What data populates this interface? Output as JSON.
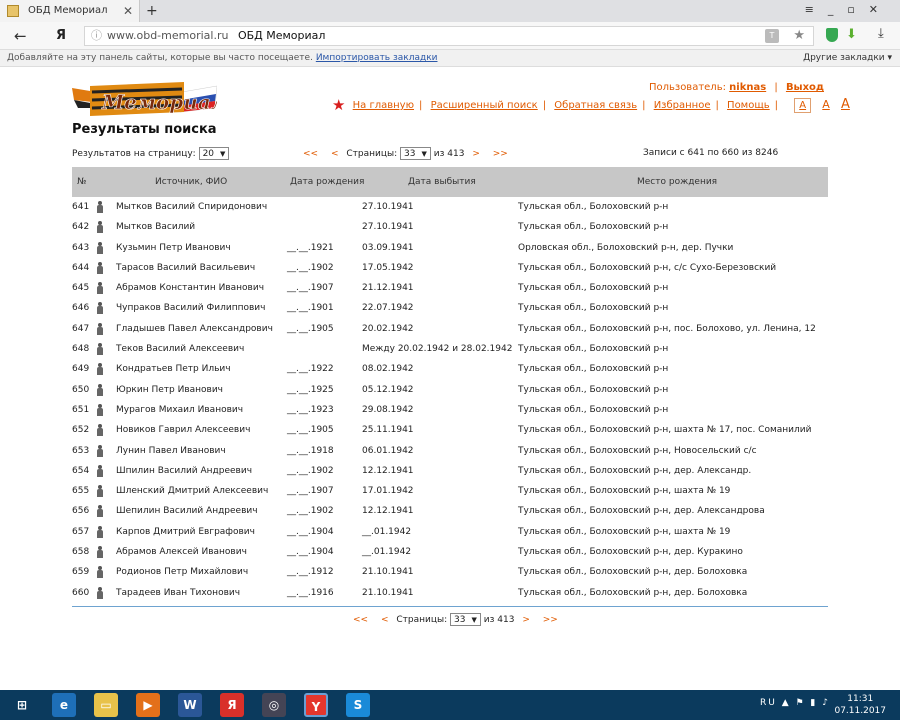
{
  "browser": {
    "tab_title": "ОБД Мемориал",
    "url_host": "www.obd-memorial.ru",
    "page_title": "ОБД Мемориал",
    "bookmarks_hint": "Добавляйте на эту панель сайты, которые вы часто посещаете.",
    "bookmarks_import": "Импортировать закладки",
    "other_bookmarks": "Другие закладки ▾",
    "logo_letter": "Я"
  },
  "header": {
    "user_label": "Пользователь:",
    "user_name": "niknas",
    "logout": "Выход",
    "nav": [
      "На главную",
      "Расширенный поиск",
      "Обратная связь",
      "Избранное",
      "Помощь"
    ],
    "font_sizes": [
      "A",
      "A",
      "A"
    ]
  },
  "main": {
    "title": "Результаты поиска",
    "per_page_label": "Результатов на страницу:",
    "per_page_value": "20",
    "pages_label": "Страницы:",
    "current_page": "33",
    "of_pages": "из 413",
    "first": "<<",
    "prev": "<",
    "next": ">",
    "last": ">>",
    "records_info": "Записи с 641 по 660 из 8246"
  },
  "table": {
    "headers": [
      "№",
      "Источник, ФИО",
      "Дата рождения",
      "Дата выбытия",
      "Место рождения"
    ],
    "rows": [
      {
        "num": "641",
        "name": "Мытков Василий Спиридонович",
        "birth": "",
        "death": "27.10.1941",
        "place": "Тульская обл., Болоховский р-н"
      },
      {
        "num": "642",
        "name": "Мытков Василий",
        "birth": "",
        "death": "27.10.1941",
        "place": "Тульская обл., Болоховский р-н"
      },
      {
        "num": "643",
        "name": "Кузьмин Петр Иванович",
        "birth": "__.__.1921",
        "death": "03.09.1941",
        "place": "Орловская обл., Болоховский р-н, дер. Пучки"
      },
      {
        "num": "644",
        "name": "Тарасов Василий Васильевич",
        "birth": "__.__.1902",
        "death": "17.05.1942",
        "place": "Тульская обл., Болоховский р-н, с/с Сухо-Березовский"
      },
      {
        "num": "645",
        "name": "Абрамов Константин Иванович",
        "birth": "__.__.1907",
        "death": "21.12.1941",
        "place": "Тульская обл., Болоховский р-н"
      },
      {
        "num": "646",
        "name": "Чупраков Василий Филиппович",
        "birth": "__.__.1901",
        "death": "22.07.1942",
        "place": "Тульская обл., Болоховский р-н"
      },
      {
        "num": "647",
        "name": "Гладышев Павел Александрович",
        "birth": "__.__.1905",
        "death": "20.02.1942",
        "place": "Тульская обл., Болоховский р-н, пос. Болохово, ул. Ленина, 12"
      },
      {
        "num": "648",
        "name": "Теков Василий Алексеевич",
        "birth": "",
        "death": "Между 20.02.1942 и 28.02.1942",
        "place": "Тульская обл., Болоховский р-н"
      },
      {
        "num": "649",
        "name": "Кондратьев Петр Ильич",
        "birth": "__.__.1922",
        "death": "08.02.1942",
        "place": "Тульская обл., Болоховский р-н"
      },
      {
        "num": "650",
        "name": "Юркин Петр Иванович",
        "birth": "__.__.1925",
        "death": "05.12.1942",
        "place": "Тульская обл., Болоховский р-н"
      },
      {
        "num": "651",
        "name": "Мурагов Михаил Иванович",
        "birth": "__.__.1923",
        "death": "29.08.1942",
        "place": "Тульская обл., Болоховский р-н"
      },
      {
        "num": "652",
        "name": "Новиков Гаврил Алексеевич",
        "birth": "__.__.1905",
        "death": "25.11.1941",
        "place": "Тульская обл., Болоховский р-н, шахта № 17, пос. Соманилий"
      },
      {
        "num": "653",
        "name": "Лунин Павел Иванович",
        "birth": "__.__.1918",
        "death": "06.01.1942",
        "place": "Тульская обл., Болоховский р-н, Новосельский с/с"
      },
      {
        "num": "654",
        "name": "Шпилин Василий Андреевич",
        "birth": "__.__.1902",
        "death": "12.12.1941",
        "place": "Тульская обл., Болоховский р-н, дер. Александр."
      },
      {
        "num": "655",
        "name": "Шленский Дмитрий Алексеевич",
        "birth": "__.__.1907",
        "death": "17.01.1942",
        "place": "Тульская обл., Болоховский р-н, шахта № 19"
      },
      {
        "num": "656",
        "name": "Шепилин Василий Андреевич",
        "birth": "__.__.1902",
        "death": "12.12.1941",
        "place": "Тульская обл., Болоховский р-н, дер. Александрова"
      },
      {
        "num": "657",
        "name": "Карпов Дмитрий Евграфович",
        "birth": "__.__.1904",
        "death": "__.01.1942",
        "place": "Тульская обл., Болоховский р-н, шахта № 19"
      },
      {
        "num": "658",
        "name": "Абрамов Алексей Иванович",
        "birth": "__.__.1904",
        "death": "__.01.1942",
        "place": "Тульская обл., Болоховский р-н, дер. Куракино"
      },
      {
        "num": "659",
        "name": "Родионов Петр Михайлович",
        "birth": "__.__.1912",
        "death": "21.10.1941",
        "place": "Тульская обл., Болоховский р-н, дер. Болоховка"
      },
      {
        "num": "660",
        "name": "Тарадеев Иван Тихонович",
        "birth": "__.__.1916",
        "death": "21.10.1941",
        "place": "Тульская обл., Болоховский р-н, дер. Болоховка"
      }
    ]
  },
  "taskbar": {
    "lang": "RU",
    "time": "11:31",
    "date": "07.11.2017"
  }
}
